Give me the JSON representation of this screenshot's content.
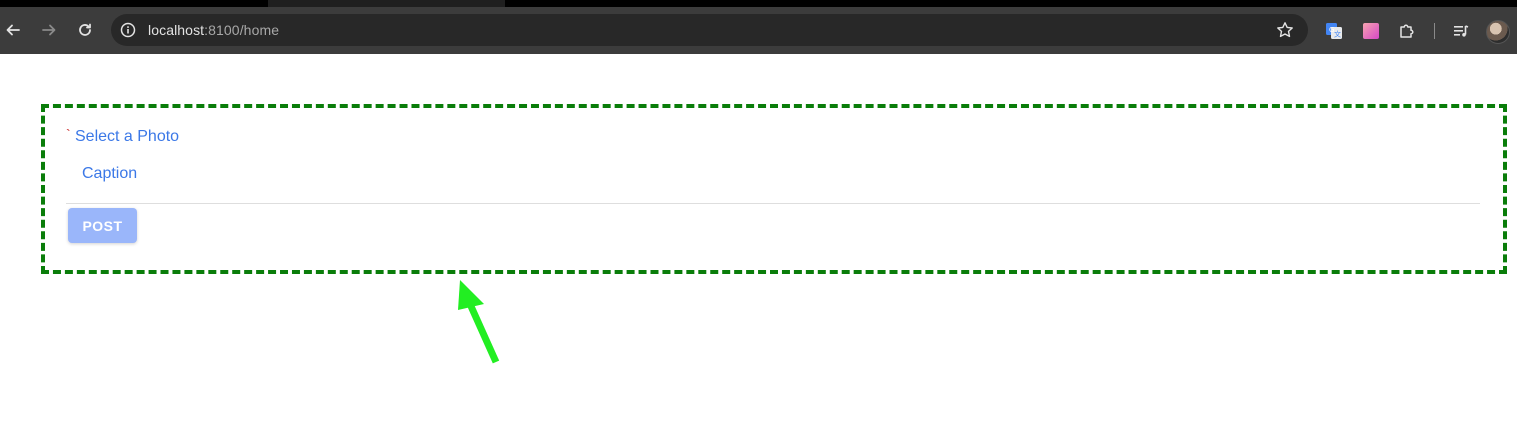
{
  "browser": {
    "url_host": "localhost",
    "url_rest": ":8100/home",
    "icons": {
      "back": "arrow-left-icon",
      "forward": "arrow-right-icon",
      "reload": "reload-icon",
      "site_info": "info-icon",
      "bookmark": "star-icon",
      "extensions": [
        "translate-icon",
        "gradient-square-icon",
        "puzzle-icon",
        "media-queue-icon"
      ],
      "profile": "avatar"
    }
  },
  "page": {
    "stray_char": "`",
    "select_photo_label": "Select a Photo",
    "caption_placeholder": "Caption",
    "post_button_label": "POST"
  },
  "colors": {
    "link_blue": "#3b78e7",
    "post_button_bg": "#9ab6fa",
    "highlight_border": "#0a7d0a",
    "annotation_arrow": "#22ee22"
  }
}
